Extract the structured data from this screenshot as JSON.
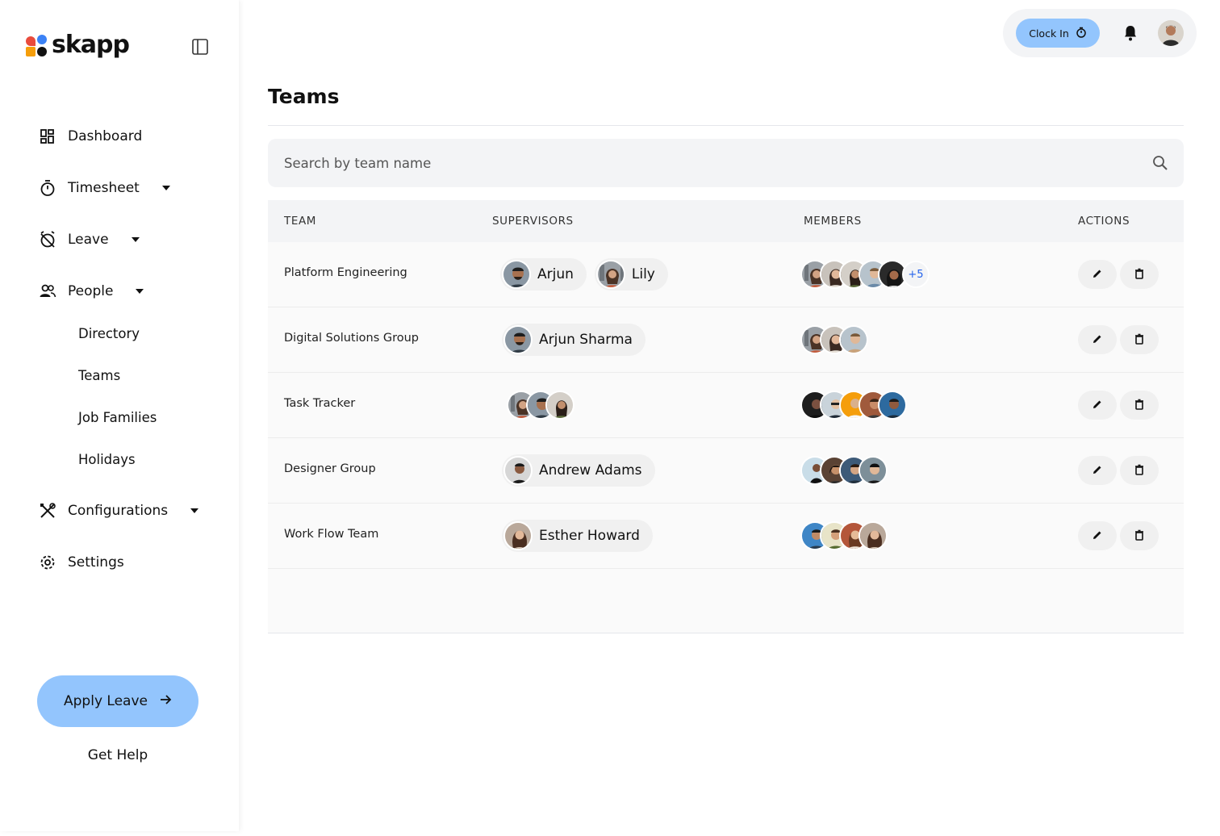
{
  "app": {
    "logo_text": "skapp"
  },
  "sidebar": {
    "items": [
      {
        "label": "Dashboard",
        "icon": "dashboard-icon",
        "has_caret": false
      },
      {
        "label": "Timesheet",
        "icon": "stopwatch-icon",
        "has_caret": true
      },
      {
        "label": "Leave",
        "icon": "alarm-off-icon",
        "has_caret": true
      },
      {
        "label": "People",
        "icon": "people-icon",
        "has_caret": true
      },
      {
        "label": "Configurations",
        "icon": "tools-icon",
        "has_caret": true
      },
      {
        "label": "Settings",
        "icon": "gear-icon",
        "has_caret": false
      }
    ],
    "people_subitems": [
      "Directory",
      "Teams",
      "Job Families",
      "Holidays"
    ],
    "apply_leave_label": "Apply Leave",
    "get_help_label": "Get Help"
  },
  "topbar": {
    "clock_in_label": "Clock In"
  },
  "page": {
    "title": "Teams",
    "search_placeholder": "Search by team name"
  },
  "table": {
    "columns": [
      "TEAM",
      "SUPERVISORS",
      "MEMBERS",
      "ACTIONS"
    ],
    "rows": [
      {
        "team": "Platform Engineering",
        "supervisors": [
          "Arjun",
          "Lily"
        ],
        "member_count_shown": 5,
        "members_more": "+5"
      },
      {
        "team": "Digital Solutions Group",
        "supervisors": [
          "Arjun Sharma"
        ],
        "member_count_shown": 3,
        "members_more": ""
      },
      {
        "team": "Task Tracker",
        "supervisors": [],
        "supervisor_avatars_shown": 3,
        "member_count_shown": 5,
        "members_more": ""
      },
      {
        "team": "Designer Group",
        "supervisors": [
          "Andrew Adams"
        ],
        "member_count_shown": 4,
        "members_more": ""
      },
      {
        "team": "Work Flow Team",
        "supervisors": [
          "Esther Howard"
        ],
        "member_count_shown": 4,
        "members_more": ""
      }
    ]
  },
  "colors": {
    "accent": "#93c5fd",
    "link": "#2563eb"
  }
}
